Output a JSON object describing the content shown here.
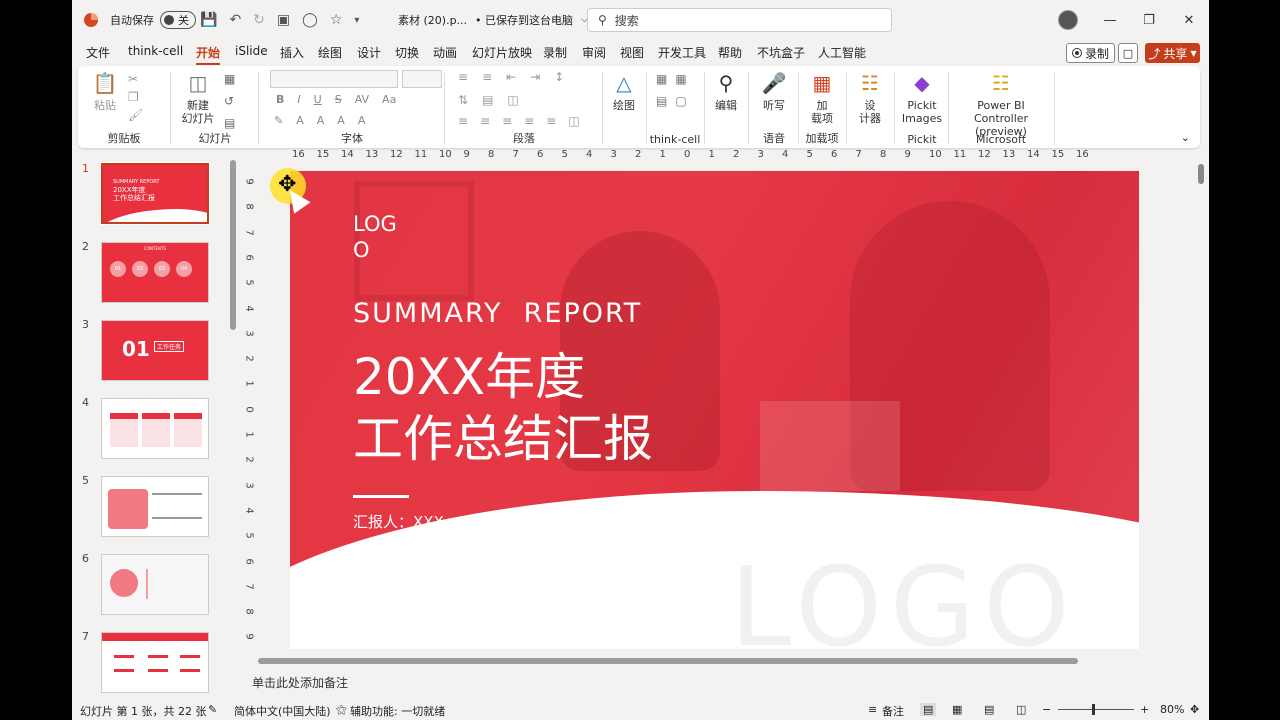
{
  "titlebar": {
    "autosave_label": "自动保存",
    "autosave_state": "关",
    "filename": "素材 (20).p...",
    "save_status": "• 已保存到这台电脑",
    "search_placeholder": "搜索"
  },
  "menu": {
    "items": [
      "文件",
      "think-cell",
      "开始",
      "iSlide",
      "插入",
      "绘图",
      "设计",
      "切换",
      "动画",
      "幻灯片放映",
      "录制",
      "审阅",
      "视图",
      "开发工具",
      "帮助",
      "不坑盒子",
      "人工智能"
    ],
    "active": "开始",
    "record_label": "录制",
    "share_label": "共享"
  },
  "ribbon": {
    "groups": {
      "clipboard": "剪贴板",
      "slides": "幻灯片",
      "font": "字体",
      "paragraph": "段落",
      "thinkcell": "think-cell",
      "voice": "语音",
      "addins": "加载项",
      "pickit": "Pickit",
      "microsoft": "Microsoft"
    },
    "paste_label": "粘贴",
    "new_slide_label1": "新建",
    "new_slide_label2": "幻灯片",
    "draw_label": "绘图",
    "edit_label": "编辑",
    "dictate_label": "听写",
    "addins_label1": "加",
    "addins_label2": "载项",
    "designer_label1": "设",
    "designer_label2": "计器",
    "pickit_label1": "Pickit",
    "pickit_label2": "Images",
    "powerbi_label1": "Power BI Controller",
    "powerbi_label2": "(preview)"
  },
  "ruler": {
    "h_ticks": [
      "16",
      "15",
      "14",
      "13",
      "12",
      "11",
      "10",
      "9",
      "8",
      "7",
      "6",
      "5",
      "4",
      "3",
      "2",
      "1",
      "0",
      "1",
      "2",
      "3",
      "4",
      "5",
      "6",
      "7",
      "8",
      "9",
      "10",
      "11",
      "12",
      "13",
      "14",
      "15",
      "16"
    ],
    "v_ticks": [
      "9",
      "8",
      "7",
      "6",
      "5",
      "4",
      "3",
      "2",
      "1",
      "0",
      "1",
      "2",
      "3",
      "4",
      "5",
      "6",
      "7",
      "8",
      "9"
    ]
  },
  "slides": {
    "numbers": [
      "1",
      "2",
      "3",
      "4",
      "5",
      "6",
      "7"
    ],
    "thumb2_title": "CONTENTS",
    "thumb2_items": [
      "01",
      "02",
      "03",
      "04"
    ],
    "thumb3_num": "01",
    "thumb3_text": "工作任务",
    "thumb1_line1": "SUMMARY REPORT",
    "thumb1_line2": "20XX年度",
    "thumb1_line3": "工作总结汇报"
  },
  "slide": {
    "logo_line1": "LOG",
    "logo_line2": "O",
    "subtitle": "SUMMARY  REPORT",
    "title_line1": "20XX年度",
    "title_line2": "工作总结汇报",
    "reporter": "汇报人：XXX",
    "watermark": "LOGO"
  },
  "notes": {
    "placeholder": "单击此处添加备注"
  },
  "status": {
    "slide_info": "幻灯片 第 1 张，共 22 张",
    "language": "简体中文(中国大陆)",
    "accessibility": "辅助功能: 一切就绪",
    "notes_btn": "备注",
    "zoom": "80%"
  },
  "colors": {
    "accent": "#c43e1c",
    "slide_red": "#e8303f"
  }
}
